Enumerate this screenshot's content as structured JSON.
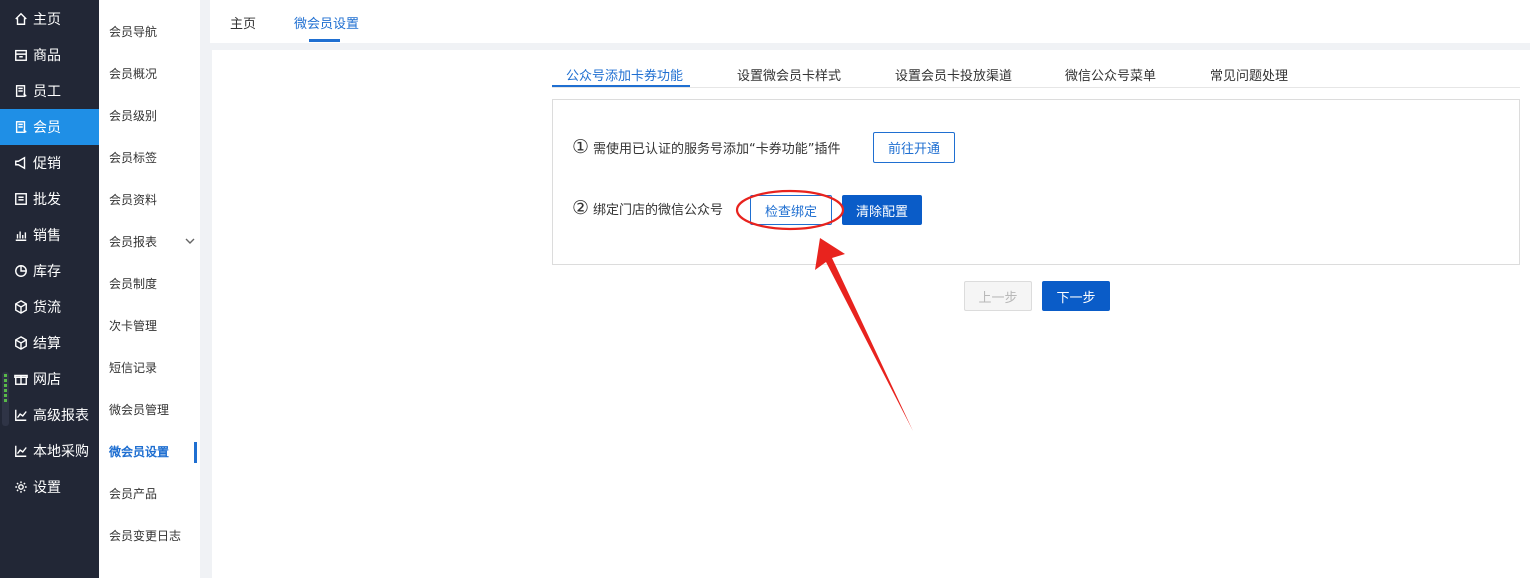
{
  "nav": {
    "items": [
      {
        "label": "主页",
        "icon": "home-icon"
      },
      {
        "label": "商品",
        "icon": "store-icon"
      },
      {
        "label": "员工",
        "icon": "staff-icon"
      },
      {
        "label": "会员",
        "icon": "member-icon"
      },
      {
        "label": "促销",
        "icon": "megaphone-icon"
      },
      {
        "label": "批发",
        "icon": "list-icon"
      },
      {
        "label": "销售",
        "icon": "bar-chart-icon"
      },
      {
        "label": "库存",
        "icon": "pie-chart-icon"
      },
      {
        "label": "货流",
        "icon": "cube-icon"
      },
      {
        "label": "结算",
        "icon": "cube-icon"
      },
      {
        "label": "网店",
        "icon": "gift-icon"
      },
      {
        "label": "高级报表",
        "icon": "line-chart-icon"
      },
      {
        "label": "本地采购",
        "icon": "line-chart-icon"
      },
      {
        "label": "设置",
        "icon": "gear-icon"
      }
    ],
    "active_color": "#1f8fe6"
  },
  "subnav": {
    "items": [
      "会员导航",
      "会员概况",
      "会员级别",
      "会员标签",
      "会员资料",
      "会员报表",
      "会员制度",
      "次卡管理",
      "短信记录",
      "微会员管理",
      "微会员设置",
      "会员产品",
      "会员变更日志"
    ]
  },
  "toptabs": [
    "主页",
    "微会员设置"
  ],
  "subtabs": [
    "公众号添加卡券功能",
    "设置微会员卡样式",
    "设置会员卡投放渠道",
    "微信公众号菜单",
    "常见问题处理"
  ],
  "steps": {
    "step1": {
      "num": "①",
      "text": "需使用已认证的服务号添加“卡券功能”插件",
      "button": "前往开通"
    },
    "step2": {
      "num": "②",
      "text": "绑定门店的微信公众号",
      "check_button": "检查绑定",
      "clear_button": "清除配置"
    }
  },
  "footer": {
    "prev": "上一步",
    "next": "下一步"
  },
  "colors": {
    "accent": "#1f6fd1",
    "primary_button": "#0a5cc8",
    "annotation": "#e8231e"
  }
}
